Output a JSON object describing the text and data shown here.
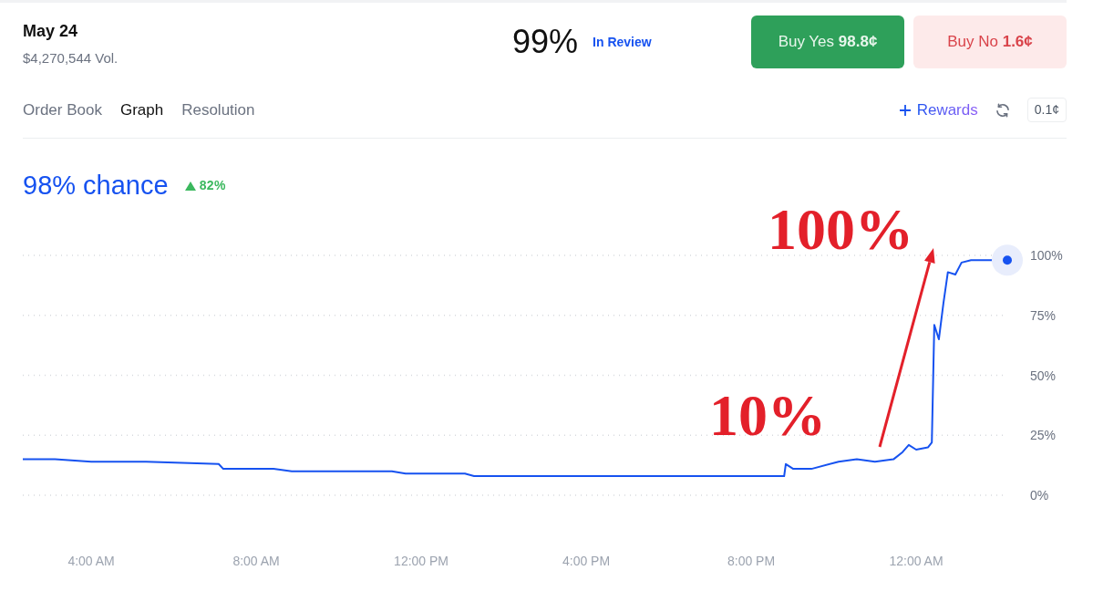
{
  "market": {
    "title": "May 24",
    "volume": "$4,270,544 Vol.",
    "probability": "99%",
    "status": "In Review"
  },
  "buttons": [
    {
      "kind": "yes",
      "label": "Buy Yes",
      "price": "98.8¢"
    },
    {
      "kind": "no",
      "label": "Buy No",
      "price": "1.6¢"
    }
  ],
  "tabs": [
    {
      "label": "Order Book",
      "selected": false
    },
    {
      "label": "Graph",
      "selected": true
    },
    {
      "label": "Resolution",
      "selected": false
    }
  ],
  "toolbar": {
    "rewards": "Rewards",
    "tick_size": "0.1¢"
  },
  "chance": {
    "value": "98% chance",
    "change": "82%"
  },
  "chart_data": {
    "type": "line",
    "grid": true,
    "xlim": [
      2.34,
      26.21
    ],
    "ylim": [
      0,
      100
    ],
    "xticks": [
      {
        "value": 4,
        "label": "4:00 AM"
      },
      {
        "value": 8,
        "label": "8:00 AM"
      },
      {
        "value": 12,
        "label": "12:00 PM"
      },
      {
        "value": 16,
        "label": "4:00 PM"
      },
      {
        "value": 20,
        "label": "8:00 PM"
      },
      {
        "value": 24,
        "label": "12:00 AM"
      }
    ],
    "yticks": [
      {
        "value": 100,
        "label": "100%"
      },
      {
        "value": 75,
        "label": "75%"
      },
      {
        "value": 50,
        "label": "50%"
      },
      {
        "value": 25,
        "label": "25%"
      },
      {
        "value": 0,
        "label": "0%"
      }
    ],
    "x": [
      2.34,
      3.12,
      4,
      5.33,
      7.09,
      7.2,
      8.42,
      8.86,
      11.29,
      11.62,
      13.06,
      13.28,
      18.59,
      20.8,
      20.84,
      21.02,
      21.46,
      22.12,
      22.56,
      23,
      23.45,
      23.67,
      23.82,
      24,
      24.29,
      24.38,
      24.44,
      24.55,
      24.66,
      24.77,
      24.95,
      25.1,
      25.33,
      25.66,
      26.21
    ],
    "series": [
      {
        "color": "#1652f0",
        "values": [
          15,
          15,
          14,
          14,
          13,
          11,
          11,
          10,
          10,
          9,
          9,
          8,
          8,
          8,
          13,
          11,
          11,
          14,
          15,
          14,
          15,
          18,
          21,
          19,
          20,
          22,
          71,
          65,
          80,
          93,
          92,
          97,
          98,
          98,
          98
        ]
      }
    ],
    "annotations": [
      {
        "text": "100%"
      },
      {
        "text": "10%"
      }
    ]
  }
}
